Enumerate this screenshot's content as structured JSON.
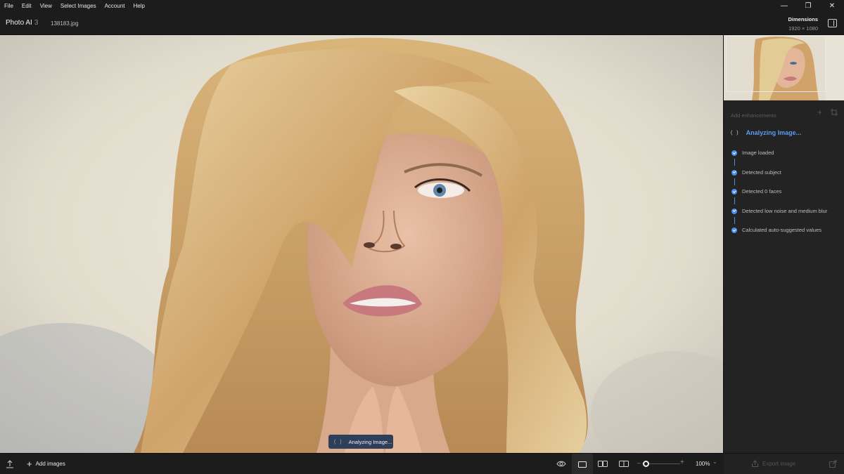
{
  "menu": {
    "items": [
      "File",
      "Edit",
      "View",
      "Select Images",
      "Account",
      "Help"
    ]
  },
  "window_controls": {
    "minimize": "—",
    "restore": "❐",
    "close": "✕"
  },
  "header": {
    "app_name": "Photo AI",
    "app_version": "3",
    "file_name": "138183.jpg",
    "dimensions_label": "Dimensions",
    "dimensions_value": "1920 × 1080"
  },
  "panel": {
    "add_enhancements": "Add enhancements",
    "analyzing_title": "Analyzing Image...",
    "spinner_glyph": "( )",
    "steps": [
      "Image loaded",
      "Detected subject",
      "Detected 0 faces",
      "Detected low noise and medium blur",
      "Calculated auto-suggested values"
    ]
  },
  "canvas": {
    "analyzing_pill": "Analyzing Image...",
    "pill_spinner": "( )"
  },
  "bottom": {
    "add_images": "Add images",
    "zoom_level": "100%",
    "export_label": "Export image"
  },
  "colors": {
    "accent": "#4d8de6",
    "accent_text": "#5a9cf2",
    "background": "#1c1c1c",
    "panel": "#232323"
  },
  "icons": [
    "upload-icon",
    "add-icon",
    "eye-icon",
    "single-view-icon",
    "side-by-side-icon",
    "split-view-icon",
    "export-icon",
    "export-settings-icon",
    "crop-icon",
    "panel-toggle-icon",
    "check-icon"
  ]
}
